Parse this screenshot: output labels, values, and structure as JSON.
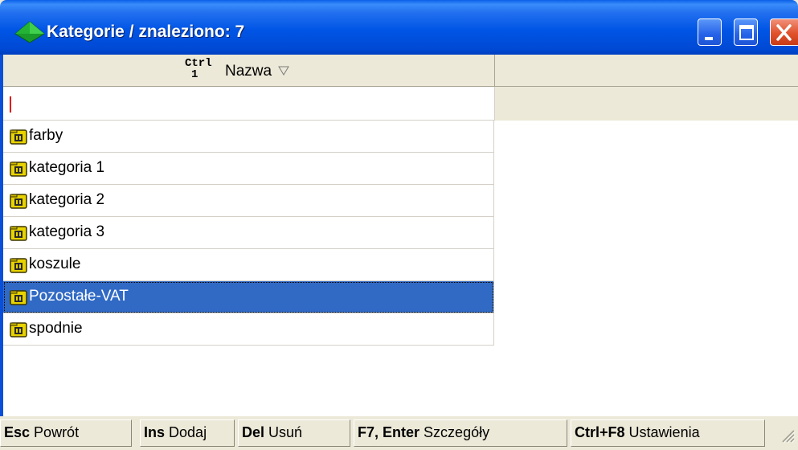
{
  "window": {
    "title": "Kategorie / znaleziono: 7",
    "icon": "green-diamond-icon",
    "controls": [
      "minimize-icon",
      "maximize-icon",
      "close-icon"
    ]
  },
  "grid": {
    "column_header": {
      "hotkey_top": "Ctrl",
      "hotkey_bottom": "1",
      "label": "Nazwa",
      "sort_icon": "sort-descending-triangle-icon"
    },
    "filter_value": "",
    "rows": [
      {
        "label": "farby",
        "icon": "folder-icon",
        "selected": false
      },
      {
        "label": "kategoria 1",
        "icon": "folder-icon",
        "selected": false
      },
      {
        "label": "kategoria 2",
        "icon": "folder-icon",
        "selected": false
      },
      {
        "label": "kategoria 3",
        "icon": "folder-icon",
        "selected": false
      },
      {
        "label": "koszule",
        "icon": "folder-icon",
        "selected": false
      },
      {
        "label": "Pozostałe-VAT",
        "icon": "folder-icon",
        "selected": true
      },
      {
        "label": "spodnie",
        "icon": "folder-icon",
        "selected": false
      }
    ]
  },
  "statusbar": {
    "items": [
      {
        "key": "Esc",
        "action": "Powrót"
      },
      {
        "key": "Ins",
        "action": "Dodaj"
      },
      {
        "key": "Del",
        "action": "Usuń"
      },
      {
        "key": "F7, Enter",
        "action": "Szczegóły"
      },
      {
        "key": "Ctrl+F8",
        "action": "Ustawienia"
      }
    ]
  },
  "colors": {
    "titlebar": "#0055e5",
    "selection": "#316ac5",
    "panel": "#ece9d8",
    "close_button": "#e0512c"
  }
}
